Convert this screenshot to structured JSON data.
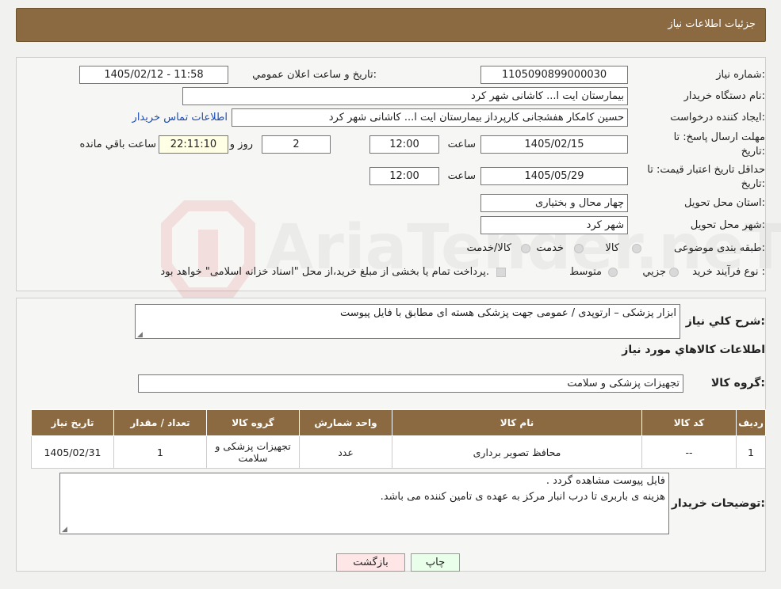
{
  "header": {
    "title": "جزئیات اطلاعات نیاز"
  },
  "form": {
    "need_number_label": "شماره نیاز:",
    "need_number": "1105090899000030",
    "announce_label": "تاريخ و ساعت اعلان عمومي:",
    "announce_value": "1405/02/12 - 11:58",
    "buyer_label": "نام دستگاه خریدار:",
    "buyer_value": "بیمارستان ایت ا... کاشانی شهر کرد",
    "creator_label": "ایجاد کننده درخواست:",
    "creator_value": "حسین کامکار هفشجانی کارپرداز بیمارستان ایت ا... کاشانی شهر کرد",
    "contact_link": "اطلاعات تماس خریدار",
    "deadline_label_1": "مهلت ارسال پاسخ: تا",
    "deadline_label_2": "تاریخ:",
    "deadline_date": "1405/02/15",
    "time_label": "ساعت",
    "deadline_time": "12:00",
    "days_value": "2",
    "days_label": "روز و",
    "remaining_value": "22:11:10",
    "remaining_label": "ساعت باقي مانده",
    "validity_label_1": "حداقل تاریخ اعتبار قیمت: تا",
    "validity_label_2": "تاریخ:",
    "validity_date": "1405/05/29",
    "validity_time": "12:00",
    "province_label": "استان محل تحویل:",
    "province_value": "چهار محال و بختیاری",
    "city_label": "شهر محل تحویل:",
    "city_value": "شهر کرد",
    "category_label": "طبقه بندی موضوعی:",
    "category_options": [
      "کالا",
      "خدمت",
      "کالا/خدمت"
    ],
    "process_label": "نوع فرآیند خرید :",
    "process_options": [
      "جزیي",
      "متوسط"
    ],
    "process_note": "پرداخت تمام یا بخشی از مبلغ خرید،از محل \"اسناد خزانه اسلامی\" خواهد بود."
  },
  "description": {
    "label": "شرح كلي نياز:",
    "value": "ابزار پزشکی – ارتوپدی / عمومی جهت پزشکی هسته ای  مطابق با فایل پیوست"
  },
  "goods": {
    "section_title": "اطلاعات كالاهاي مورد نياز",
    "group_label": "گروه کالا:",
    "group_value": "تجهیزات پزشکی و سلامت",
    "columns": [
      "رديف",
      "كد كالا",
      "نام كالا",
      "واحد شمارش",
      "گروه كالا",
      "تعداد / مقدار",
      "تاريخ نياز"
    ],
    "rows": [
      [
        "1",
        "--",
        "محافظ تصویر برداری",
        "عدد",
        "تجهیزات پزشکی و سلامت",
        "1",
        "1405/02/31"
      ]
    ]
  },
  "buyer_notes": {
    "label": "توضيحات خريدار:",
    "line1": "فایل پیوست مشاهده گردد .",
    "line2": "هزینه ی باربری تا درب انبار مرکز به عهده ی تامین کننده می باشد."
  },
  "buttons": {
    "print": "چاپ",
    "back": "بازگشت"
  },
  "watermark": {
    "text": "AriaTender.neT"
  },
  "colors": {
    "header_bg": "#8b6a42",
    "print_bg": "#eaffea",
    "back_bg": "#ffe6e6",
    "link": "#1a4cb8"
  }
}
